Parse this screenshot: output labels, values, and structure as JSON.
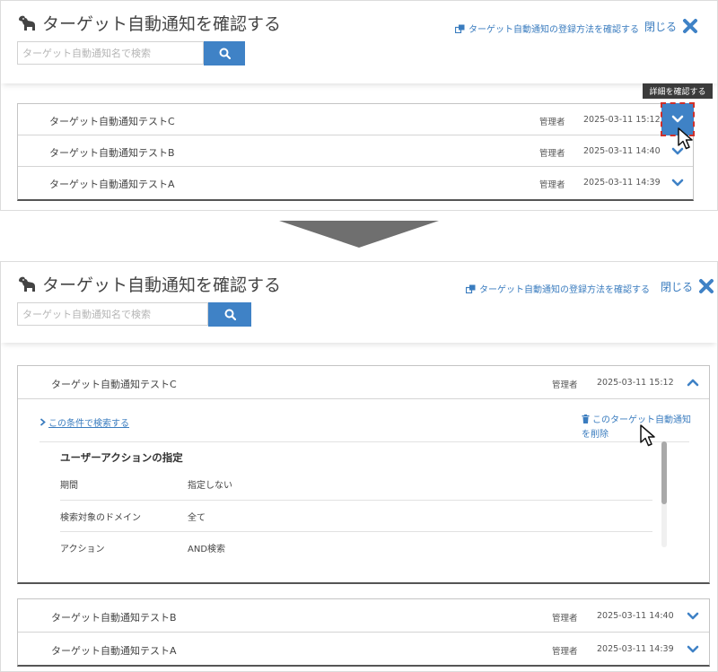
{
  "page": {
    "title": "ターゲット自動通知を確認する",
    "search_placeholder": "ターゲット自動通知名で検索",
    "howto_link": "ターゲット自動通知の登録方法を確認する",
    "close_label": "閉じる"
  },
  "colors": {
    "accent": "#3f82c6",
    "link": "#3a7cbf",
    "highlight_border": "#d0302a",
    "tooltip_bg": "#3b3b3b",
    "arrow": "#6f6f6f"
  },
  "tooltip": "詳細を確認する",
  "list_before": [
    {
      "name": "ターゲット自動通知テストC",
      "author": "管理者",
      "date": "2025-03-11 15:12",
      "state": "hovered"
    },
    {
      "name": "ターゲット自動通知テストB",
      "author": "管理者",
      "date": "2025-03-11 14:40",
      "state": "collapsed"
    },
    {
      "name": "ターゲット自動通知テストA",
      "author": "管理者",
      "date": "2025-03-11 14:39",
      "state": "collapsed"
    }
  ],
  "expanded_item": {
    "name": "ターゲット自動通知テストC",
    "author": "管理者",
    "date": "2025-03-11 15:12",
    "search_condition_link": "この条件で検索する",
    "delete_link": "このターゲット自動通知を削除",
    "detail_title": "ユーザーアクションの指定",
    "details": [
      {
        "label": "期間",
        "value": "指定しない"
      },
      {
        "label": "検索対象のドメイン",
        "value": "全て"
      },
      {
        "label": "アクション",
        "value": "AND検索"
      }
    ]
  },
  "list_after": [
    {
      "name": "ターゲット自動通知テストB",
      "author": "管理者",
      "date": "2025-03-11 14:40"
    },
    {
      "name": "ターゲット自動通知テストA",
      "author": "管理者",
      "date": "2025-03-11 14:39"
    }
  ],
  "icons": {
    "title": "dog-icon",
    "search": "search-icon",
    "howto": "external-window-icon",
    "close": "close-x-icon",
    "chevron": "chevron-icon",
    "delete": "trash-icon",
    "cursor": "mouse-cursor-icon"
  }
}
